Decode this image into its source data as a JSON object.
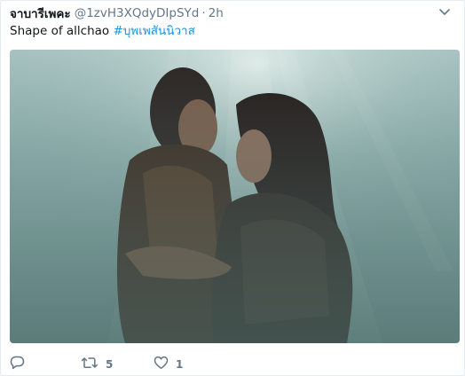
{
  "tweet": {
    "author_name": "จาบารีเพคะ",
    "handle": "@1zvH3XQdyDIpSYd",
    "separator": "·",
    "time": "2h",
    "text": "Shape of allchao ",
    "hashtag": "#บุพเพสันนิวาส",
    "media_description_icon": "photo"
  },
  "actions": {
    "reply_count": "",
    "retweet_count": "5",
    "like_count": "1"
  },
  "colors": {
    "link": "#1b95e0",
    "muted": "#657786",
    "text": "#14171a"
  }
}
